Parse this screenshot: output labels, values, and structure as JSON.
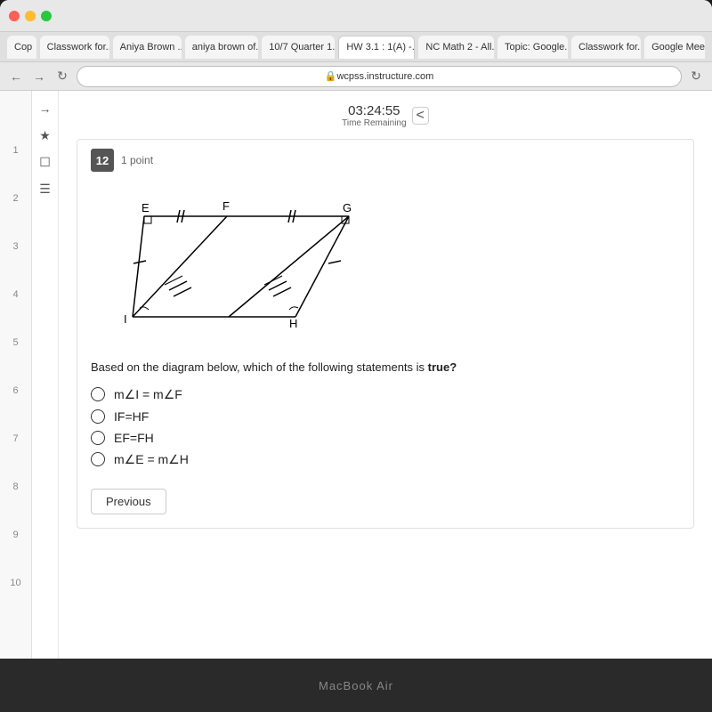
{
  "browser": {
    "url": "wcpss.instructure.com",
    "tabs": [
      {
        "label": "Cop",
        "active": false
      },
      {
        "label": "Classwork for...",
        "active": false
      },
      {
        "label": "Aniya Brown ...",
        "active": false
      },
      {
        "label": "aniya brown of...",
        "active": false
      },
      {
        "label": "10/7 Quarter 1...",
        "active": false
      },
      {
        "label": "HW 3.1 : 1(A) -...",
        "active": false
      },
      {
        "label": "NC Math 2 - All...",
        "active": false
      },
      {
        "label": "Topic: Google...",
        "active": false
      },
      {
        "label": "Classwork for...",
        "active": false
      },
      {
        "label": "Google Meet",
        "active": false
      }
    ]
  },
  "timer": {
    "time": "03:24:55",
    "label": "Time Remaining"
  },
  "question": {
    "number": "12",
    "points": "1 point",
    "text": "Based on the diagram below, which of the following statements is",
    "text_bold": "true?",
    "options": [
      {
        "id": "opt1",
        "label": "m∠I = m∠F"
      },
      {
        "id": "opt2",
        "label": "IF=HF"
      },
      {
        "id": "opt3",
        "label": "EF=FH"
      },
      {
        "id": "opt4",
        "label": "m∠E = m∠H"
      }
    ]
  },
  "buttons": {
    "previous": "Previous"
  },
  "sidebar_numbers": [
    "1",
    "2",
    "3",
    "4",
    "5",
    "6",
    "7",
    "8",
    "9",
    "10"
  ],
  "macbook_label": "MacBook Air"
}
